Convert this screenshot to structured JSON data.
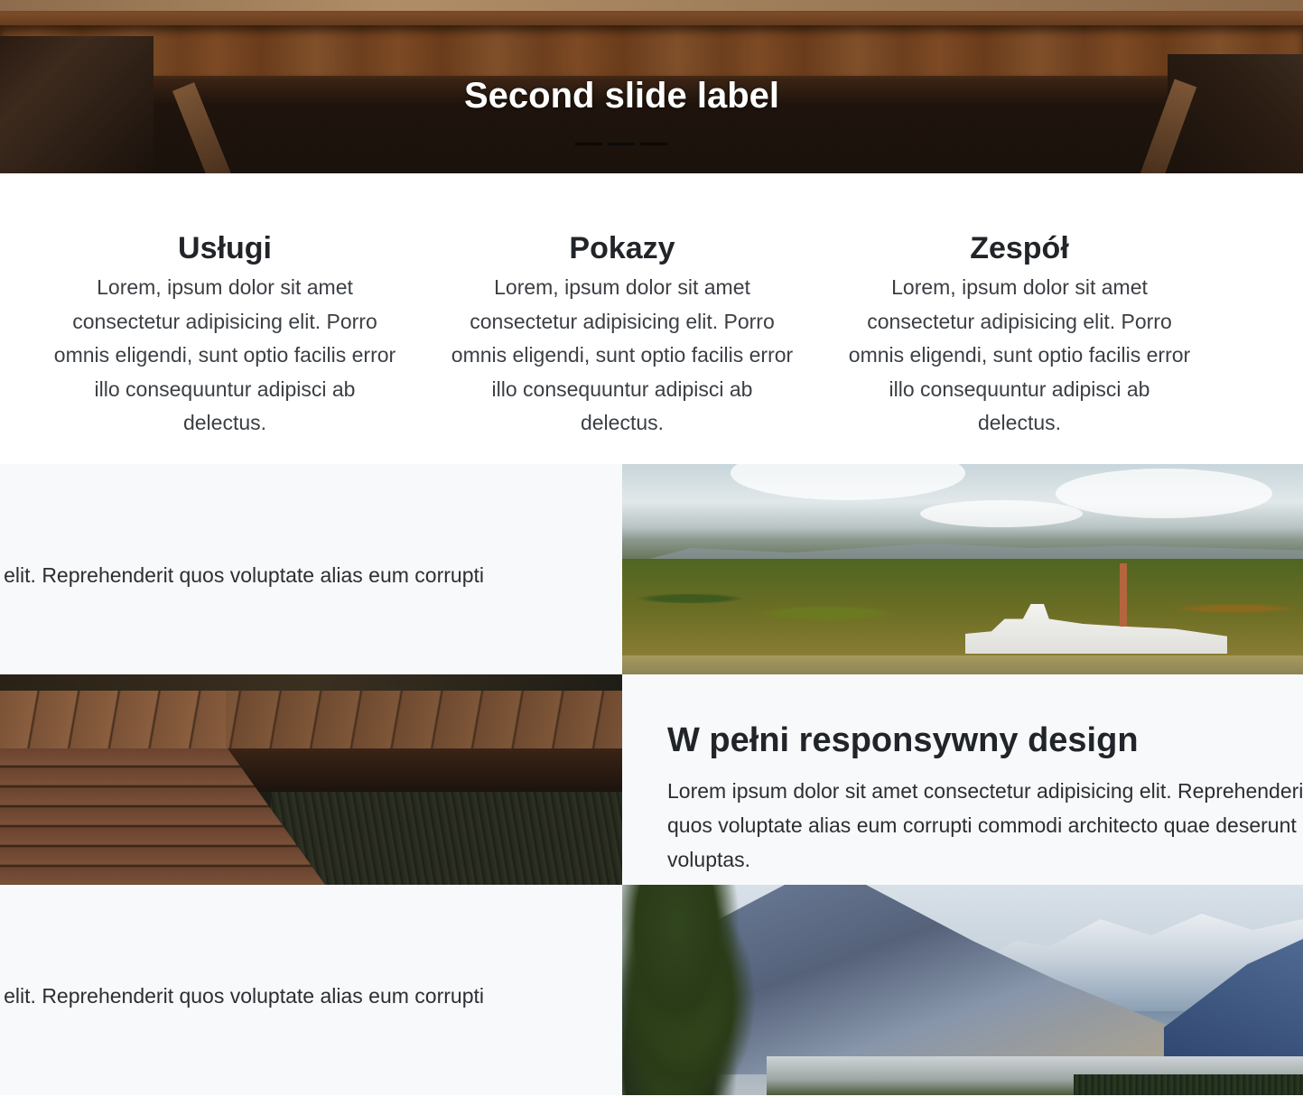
{
  "hero": {
    "caption": "Second slide label",
    "indicators": [
      {
        "active": false
      },
      {
        "active": true
      },
      {
        "active": false
      }
    ]
  },
  "features": [
    {
      "title": "Usługi",
      "text": "Lorem, ipsum dolor sit amet consectetur adipisicing elit. Porro omnis eligendi, sunt optio facilis error illo consequuntur adipisci ab delectus."
    },
    {
      "title": "Pokazy",
      "text": "Lorem, ipsum dolor sit amet consectetur adipisicing elit. Porro omnis eligendi, sunt optio facilis error illo consequuntur adipisci ab delectus."
    },
    {
      "title": "Zespół",
      "text": "Lorem, ipsum dolor sit amet consectetur adipisicing elit. Porro omnis eligendi, sunt optio facilis error illo consequuntur adipisci ab delectus."
    }
  ],
  "showcase": {
    "row1_text": "elit. Reprehenderit quos voluptate alias eum corrupti",
    "row2_title": "W pełni responsywny design",
    "row2_text": "Lorem ipsum dolor sit amet consectetur adipisicing elit. Reprehenderit quos voluptate alias eum corrupti commodi architecto quae deserunt quas voluptas.",
    "row3_text": "elit. Reprehenderit quos voluptate alias eum corrupti"
  },
  "images": {
    "row1": "lake-factory-landscape",
    "row2": "wooden-boardwalk",
    "row3": "mountain-valley"
  }
}
